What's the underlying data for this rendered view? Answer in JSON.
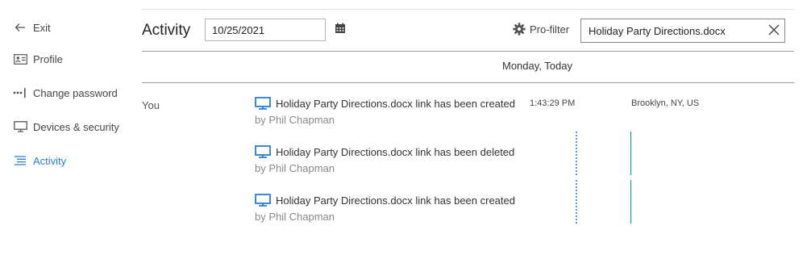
{
  "sidebar": {
    "items": [
      {
        "label": "Exit",
        "icon": "arrow-left-icon"
      },
      {
        "label": "Profile",
        "icon": "id-card-icon"
      },
      {
        "label": "Change password",
        "icon": "password-icon"
      },
      {
        "label": "Devices & security",
        "icon": "monitor-icon"
      },
      {
        "label": "Activity",
        "icon": "list-icon",
        "active": true
      }
    ]
  },
  "header": {
    "title": "Activity",
    "date_value": "10/25/2021",
    "pro_filter_label": "Pro-filter",
    "search_value": "Holiday Party Directions.docx"
  },
  "day_label": "Monday, Today",
  "actor": "You",
  "time": "1:43:29 PM",
  "location": "Brooklyn, NY, US",
  "entries": [
    {
      "text": "Holiday Party Directions.docx link has been created",
      "by": "by",
      "user": "Phil Chapman"
    },
    {
      "text": "Holiday Party Directions.docx link has been deleted",
      "by": "by",
      "user": "Phil Chapman"
    },
    {
      "text": "Holiday Party Directions.docx link has been created",
      "by": "by",
      "user": "Phil Chapman"
    }
  ],
  "colors": {
    "accent": "#2a7ed0",
    "timeline_dotted": "#5a9bd6",
    "timeline_solid": "#2a8a6a"
  }
}
